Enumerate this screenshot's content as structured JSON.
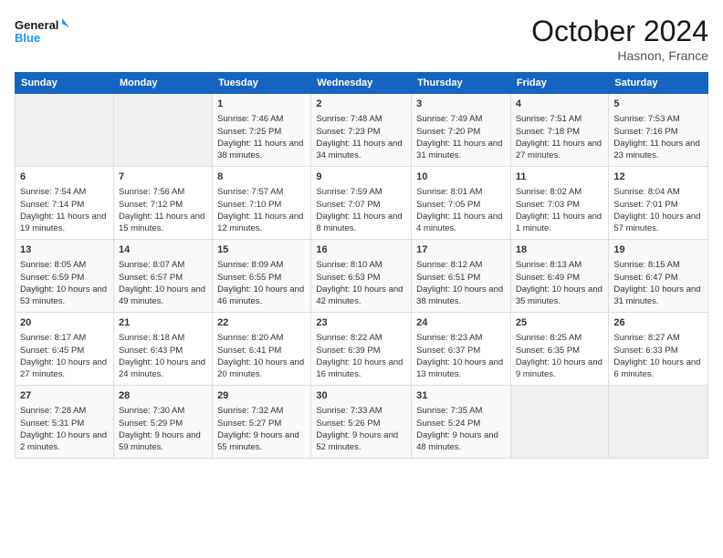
{
  "header": {
    "logo_line1": "General",
    "logo_line2": "Blue",
    "month_title": "October 2024",
    "location": "Hasnon, France"
  },
  "weekdays": [
    "Sunday",
    "Monday",
    "Tuesday",
    "Wednesday",
    "Thursday",
    "Friday",
    "Saturday"
  ],
  "weeks": [
    [
      {
        "day": "",
        "sunrise": "",
        "sunset": "",
        "daylight": ""
      },
      {
        "day": "",
        "sunrise": "",
        "sunset": "",
        "daylight": ""
      },
      {
        "day": "1",
        "sunrise": "Sunrise: 7:46 AM",
        "sunset": "Sunset: 7:25 PM",
        "daylight": "Daylight: 11 hours and 38 minutes."
      },
      {
        "day": "2",
        "sunrise": "Sunrise: 7:48 AM",
        "sunset": "Sunset: 7:23 PM",
        "daylight": "Daylight: 11 hours and 34 minutes."
      },
      {
        "day": "3",
        "sunrise": "Sunrise: 7:49 AM",
        "sunset": "Sunset: 7:20 PM",
        "daylight": "Daylight: 11 hours and 31 minutes."
      },
      {
        "day": "4",
        "sunrise": "Sunrise: 7:51 AM",
        "sunset": "Sunset: 7:18 PM",
        "daylight": "Daylight: 11 hours and 27 minutes."
      },
      {
        "day": "5",
        "sunrise": "Sunrise: 7:53 AM",
        "sunset": "Sunset: 7:16 PM",
        "daylight": "Daylight: 11 hours and 23 minutes."
      }
    ],
    [
      {
        "day": "6",
        "sunrise": "Sunrise: 7:54 AM",
        "sunset": "Sunset: 7:14 PM",
        "daylight": "Daylight: 11 hours and 19 minutes."
      },
      {
        "day": "7",
        "sunrise": "Sunrise: 7:56 AM",
        "sunset": "Sunset: 7:12 PM",
        "daylight": "Daylight: 11 hours and 15 minutes."
      },
      {
        "day": "8",
        "sunrise": "Sunrise: 7:57 AM",
        "sunset": "Sunset: 7:10 PM",
        "daylight": "Daylight: 11 hours and 12 minutes."
      },
      {
        "day": "9",
        "sunrise": "Sunrise: 7:59 AM",
        "sunset": "Sunset: 7:07 PM",
        "daylight": "Daylight: 11 hours and 8 minutes."
      },
      {
        "day": "10",
        "sunrise": "Sunrise: 8:01 AM",
        "sunset": "Sunset: 7:05 PM",
        "daylight": "Daylight: 11 hours and 4 minutes."
      },
      {
        "day": "11",
        "sunrise": "Sunrise: 8:02 AM",
        "sunset": "Sunset: 7:03 PM",
        "daylight": "Daylight: 11 hours and 1 minute."
      },
      {
        "day": "12",
        "sunrise": "Sunrise: 8:04 AM",
        "sunset": "Sunset: 7:01 PM",
        "daylight": "Daylight: 10 hours and 57 minutes."
      }
    ],
    [
      {
        "day": "13",
        "sunrise": "Sunrise: 8:05 AM",
        "sunset": "Sunset: 6:59 PM",
        "daylight": "Daylight: 10 hours and 53 minutes."
      },
      {
        "day": "14",
        "sunrise": "Sunrise: 8:07 AM",
        "sunset": "Sunset: 6:57 PM",
        "daylight": "Daylight: 10 hours and 49 minutes."
      },
      {
        "day": "15",
        "sunrise": "Sunrise: 8:09 AM",
        "sunset": "Sunset: 6:55 PM",
        "daylight": "Daylight: 10 hours and 46 minutes."
      },
      {
        "day": "16",
        "sunrise": "Sunrise: 8:10 AM",
        "sunset": "Sunset: 6:53 PM",
        "daylight": "Daylight: 10 hours and 42 minutes."
      },
      {
        "day": "17",
        "sunrise": "Sunrise: 8:12 AM",
        "sunset": "Sunset: 6:51 PM",
        "daylight": "Daylight: 10 hours and 38 minutes."
      },
      {
        "day": "18",
        "sunrise": "Sunrise: 8:13 AM",
        "sunset": "Sunset: 6:49 PM",
        "daylight": "Daylight: 10 hours and 35 minutes."
      },
      {
        "day": "19",
        "sunrise": "Sunrise: 8:15 AM",
        "sunset": "Sunset: 6:47 PM",
        "daylight": "Daylight: 10 hours and 31 minutes."
      }
    ],
    [
      {
        "day": "20",
        "sunrise": "Sunrise: 8:17 AM",
        "sunset": "Sunset: 6:45 PM",
        "daylight": "Daylight: 10 hours and 27 minutes."
      },
      {
        "day": "21",
        "sunrise": "Sunrise: 8:18 AM",
        "sunset": "Sunset: 6:43 PM",
        "daylight": "Daylight: 10 hours and 24 minutes."
      },
      {
        "day": "22",
        "sunrise": "Sunrise: 8:20 AM",
        "sunset": "Sunset: 6:41 PM",
        "daylight": "Daylight: 10 hours and 20 minutes."
      },
      {
        "day": "23",
        "sunrise": "Sunrise: 8:22 AM",
        "sunset": "Sunset: 6:39 PM",
        "daylight": "Daylight: 10 hours and 16 minutes."
      },
      {
        "day": "24",
        "sunrise": "Sunrise: 8:23 AM",
        "sunset": "Sunset: 6:37 PM",
        "daylight": "Daylight: 10 hours and 13 minutes."
      },
      {
        "day": "25",
        "sunrise": "Sunrise: 8:25 AM",
        "sunset": "Sunset: 6:35 PM",
        "daylight": "Daylight: 10 hours and 9 minutes."
      },
      {
        "day": "26",
        "sunrise": "Sunrise: 8:27 AM",
        "sunset": "Sunset: 6:33 PM",
        "daylight": "Daylight: 10 hours and 6 minutes."
      }
    ],
    [
      {
        "day": "27",
        "sunrise": "Sunrise: 7:28 AM",
        "sunset": "Sunset: 5:31 PM",
        "daylight": "Daylight: 10 hours and 2 minutes."
      },
      {
        "day": "28",
        "sunrise": "Sunrise: 7:30 AM",
        "sunset": "Sunset: 5:29 PM",
        "daylight": "Daylight: 9 hours and 59 minutes."
      },
      {
        "day": "29",
        "sunrise": "Sunrise: 7:32 AM",
        "sunset": "Sunset: 5:27 PM",
        "daylight": "Daylight: 9 hours and 55 minutes."
      },
      {
        "day": "30",
        "sunrise": "Sunrise: 7:33 AM",
        "sunset": "Sunset: 5:26 PM",
        "daylight": "Daylight: 9 hours and 52 minutes."
      },
      {
        "day": "31",
        "sunrise": "Sunrise: 7:35 AM",
        "sunset": "Sunset: 5:24 PM",
        "daylight": "Daylight: 9 hours and 48 minutes."
      },
      {
        "day": "",
        "sunrise": "",
        "sunset": "",
        "daylight": ""
      },
      {
        "day": "",
        "sunrise": "",
        "sunset": "",
        "daylight": ""
      }
    ]
  ]
}
